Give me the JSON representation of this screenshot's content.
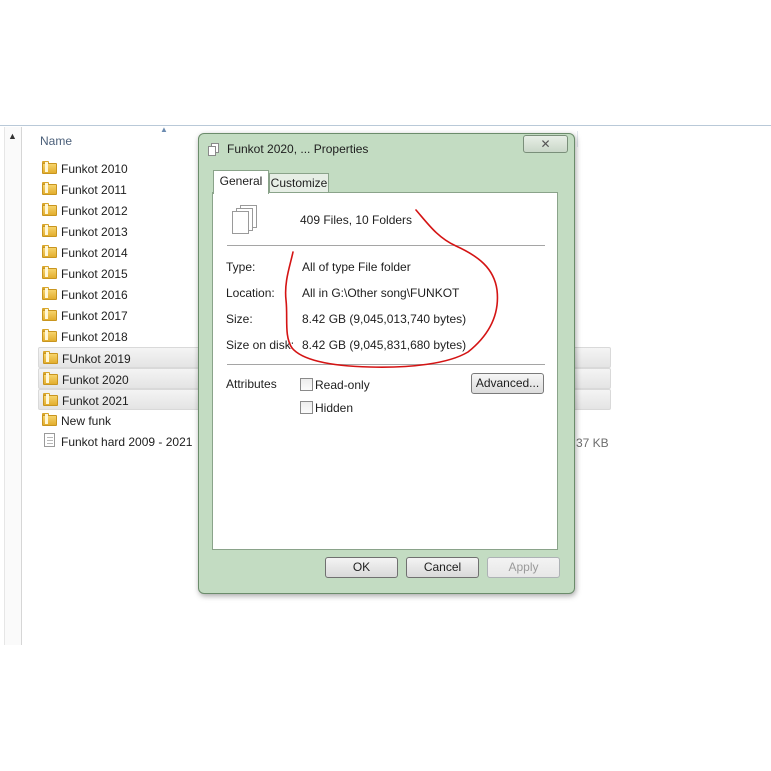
{
  "explorer": {
    "column_name": "Name",
    "rows": [
      {
        "label": "Funkot 2010",
        "type": "folder",
        "selected": false
      },
      {
        "label": "Funkot 2011",
        "type": "folder",
        "selected": false
      },
      {
        "label": "Funkot 2012",
        "type": "folder",
        "selected": false
      },
      {
        "label": "Funkot 2013",
        "type": "folder",
        "selected": false
      },
      {
        "label": "Funkot 2014",
        "type": "folder",
        "selected": false
      },
      {
        "label": "Funkot 2015",
        "type": "folder",
        "selected": false
      },
      {
        "label": "Funkot 2016",
        "type": "folder",
        "selected": false
      },
      {
        "label": "Funkot 2017",
        "type": "folder",
        "selected": false
      },
      {
        "label": "Funkot 2018",
        "type": "folder",
        "selected": false
      },
      {
        "label": "FUnkot 2019",
        "type": "folder",
        "selected": true
      },
      {
        "label": "Funkot 2020",
        "type": "folder",
        "selected": true
      },
      {
        "label": "Funkot 2021",
        "type": "folder",
        "selected": true
      },
      {
        "label": "New funk",
        "type": "folder",
        "selected": false
      },
      {
        "label": "Funkot hard 2009 - 2021",
        "type": "file",
        "selected": false
      }
    ],
    "file_size_partial": "37 KB"
  },
  "dialog": {
    "title": "Funkot 2020, ... Properties",
    "close_glyph": "✕",
    "tabs": [
      "General",
      "Customize"
    ],
    "files_count": "409 Files, 10 Folders",
    "properties": [
      {
        "label": "Type:",
        "value": "All of type File folder"
      },
      {
        "label": "Location:",
        "value": "All in G:\\Other song\\FUNKOT"
      },
      {
        "label": "Size:",
        "value": "8.42 GB (9,045,013,740 bytes)"
      },
      {
        "label": "Size on disk:",
        "value": "8.42 GB (9,045,831,680 bytes)"
      }
    ],
    "attributes_label": "Attributes",
    "readonly_label": "Read-only",
    "hidden_label": "Hidden",
    "advanced_label": "Advanced...",
    "ok_label": "OK",
    "cancel_label": "Cancel",
    "apply_label": "Apply"
  },
  "colors": {
    "annotation": "#d41414",
    "dialog_frame": "#c3dcc2",
    "folder": "#e2ae2e"
  }
}
